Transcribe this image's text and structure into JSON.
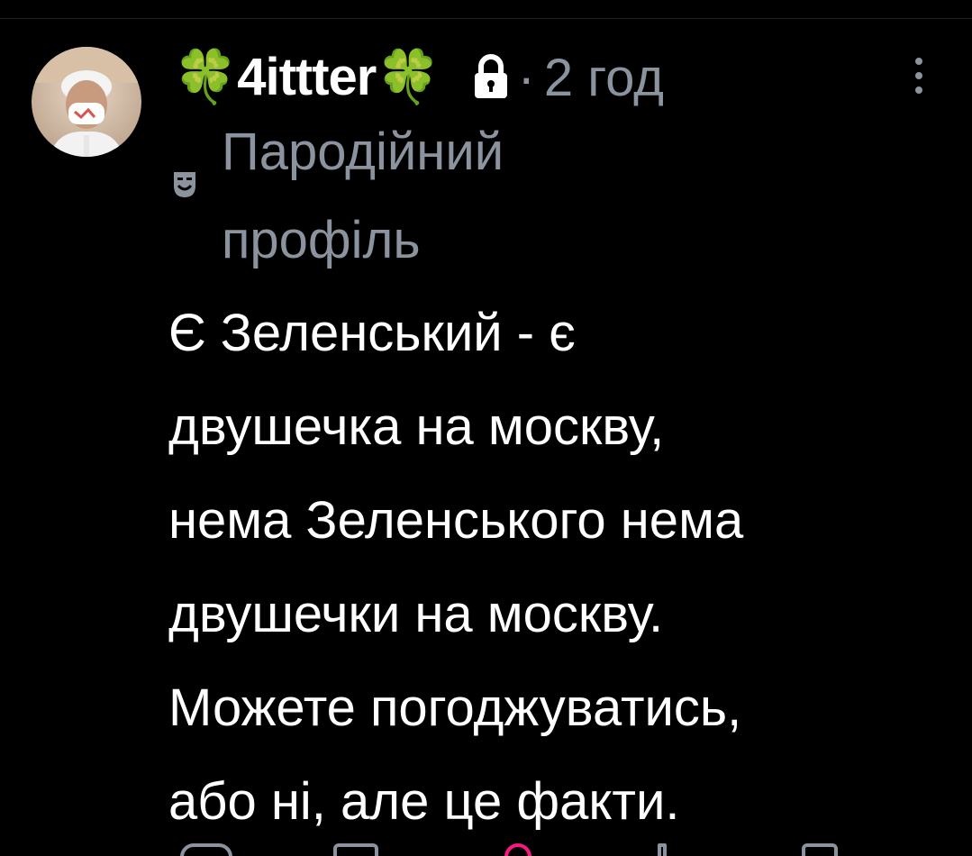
{
  "post": {
    "display_name": "🍀4ittter🍀",
    "separator": "·",
    "time_ago": "2 год",
    "parody_label": "Пародійний профіль",
    "body_lines": [
      "Є Зеленський - є",
      "двушечка на москву,",
      "нема Зеленського нема",
      "двушечки на москву.",
      "Можете погоджуватись,",
      "або ні, але це факти."
    ]
  },
  "icons": {
    "avatar": "avatar",
    "lock": "lock-icon",
    "parody": "theater-mask-icon",
    "more": "more-vertical-icon",
    "actions": [
      "reply-icon",
      "repost-icon",
      "like-icon",
      "stats-icon",
      "share-icon"
    ]
  },
  "colors": {
    "background": "#000000",
    "text_primary": "#ffffff",
    "text_secondary": "#8b949e",
    "like_accent": "#f91880"
  }
}
